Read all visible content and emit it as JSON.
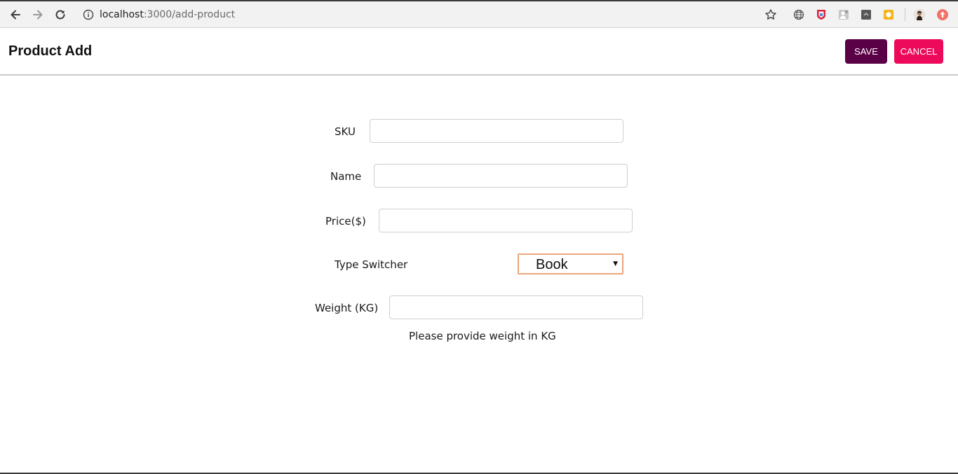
{
  "browser": {
    "url_host": "localhost",
    "url_rest": ":3000/add-product",
    "icons": [
      "back-arrow-icon",
      "forward-arrow-icon",
      "reload-icon",
      "info-icon",
      "star-icon"
    ],
    "extensions": [
      "globe-extension-icon",
      "shield-extension-icon",
      "user-extension-icon",
      "dark-extension-icon",
      "yellow-extension-icon",
      "profile-avatar",
      "update-icon"
    ]
  },
  "header": {
    "title": "Product Add",
    "save_label": "SAVE",
    "cancel_label": "CANCEL",
    "save_color": "#5a0047",
    "cancel_color": "#ee0a5a"
  },
  "form": {
    "sku": {
      "label": "SKU",
      "value": ""
    },
    "name": {
      "label": "Name",
      "value": ""
    },
    "price": {
      "label": "Price($)",
      "value": ""
    },
    "type_switcher": {
      "label": "Type Switcher",
      "selected": "Book"
    },
    "weight": {
      "label": "Weight (KG)",
      "value": "",
      "helper": "Please provide weight in KG"
    }
  }
}
